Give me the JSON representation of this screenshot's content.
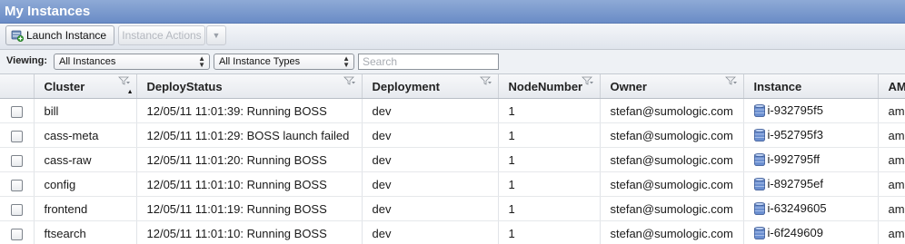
{
  "panel": {
    "title": "My Instances"
  },
  "toolbar": {
    "launch_label": "Launch Instance",
    "actions_label": "Instance Actions"
  },
  "filter": {
    "viewing_label": "Viewing:",
    "instances_value": "All Instances",
    "types_value": "All Instance Types",
    "search_placeholder": "Search"
  },
  "columns": [
    "Cluster",
    "DeployStatus",
    "Deployment",
    "NodeNumber",
    "Owner",
    "Instance",
    "AMI"
  ],
  "rows": [
    {
      "cluster": "bill",
      "status": "12/05/11 11:01:39: Running BOSS",
      "deployment": "dev",
      "node": "1",
      "owner": "stefan@sumologic.com",
      "instance": "i-932795f5",
      "ami": "ami"
    },
    {
      "cluster": "cass-meta",
      "status": "12/05/11 11:01:29: BOSS launch failed",
      "deployment": "dev",
      "node": "1",
      "owner": "stefan@sumologic.com",
      "instance": "i-952795f3",
      "ami": "ami"
    },
    {
      "cluster": "cass-raw",
      "status": "12/05/11 11:01:20: Running BOSS",
      "deployment": "dev",
      "node": "1",
      "owner": "stefan@sumologic.com",
      "instance": "i-992795ff",
      "ami": "ami"
    },
    {
      "cluster": "config",
      "status": "12/05/11 11:01:10: Running BOSS",
      "deployment": "dev",
      "node": "1",
      "owner": "stefan@sumologic.com",
      "instance": "i-892795ef",
      "ami": "ami"
    },
    {
      "cluster": "frontend",
      "status": "12/05/11 11:01:19: Running BOSS",
      "deployment": "dev",
      "node": "1",
      "owner": "stefan@sumologic.com",
      "instance": "i-63249605",
      "ami": "ami"
    },
    {
      "cluster": "ftsearch",
      "status": "12/05/11 11:01:10: Running BOSS",
      "deployment": "dev",
      "node": "1",
      "owner": "stefan@sumologic.com",
      "instance": "i-6f249609",
      "ami": "ami"
    }
  ]
}
